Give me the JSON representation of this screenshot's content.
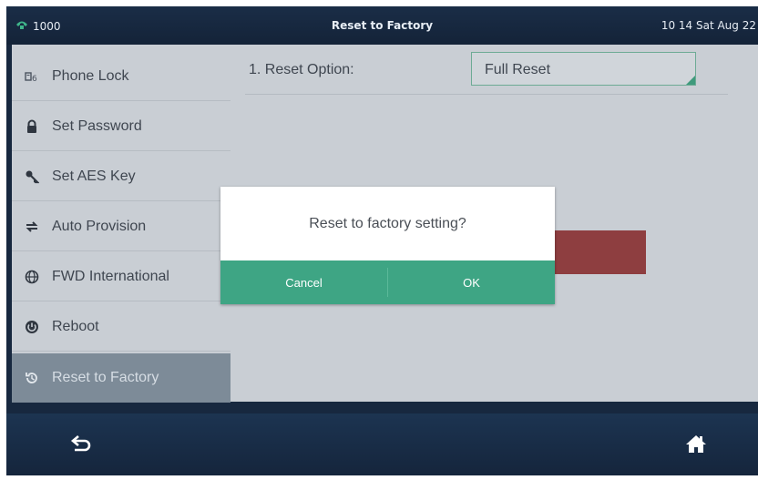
{
  "statusbar": {
    "line": "1000",
    "title": "Reset to Factory",
    "datetime": "10 14 Sat Aug 22"
  },
  "sidebar": {
    "items": [
      {
        "label": "Phone Lock",
        "icon": "phone-lock-icon"
      },
      {
        "label": "Set Password",
        "icon": "lock-icon"
      },
      {
        "label": "Set AES Key",
        "icon": "key-icon"
      },
      {
        "label": "Auto Provision",
        "icon": "sync-icon"
      },
      {
        "label": "FWD International",
        "icon": "globe-icon"
      },
      {
        "label": "Reboot",
        "icon": "reboot-icon"
      },
      {
        "label": "Reset to Factory",
        "icon": "reset-icon",
        "active": true
      }
    ]
  },
  "content": {
    "reset_option_label": "1. Reset Option:",
    "reset_option_value": "Full Reset"
  },
  "dialog": {
    "message": "Reset to factory setting?",
    "cancel_label": "Cancel",
    "ok_label": "OK"
  },
  "bottombar": {
    "back_icon": "back-arrow-icon",
    "home_icon": "home-icon"
  },
  "colors": {
    "accent": "#3ea584",
    "bezel": "#17283f",
    "panel": "#c9ced4",
    "active_item": "#7d8b98",
    "danger": "#8e3e40"
  }
}
